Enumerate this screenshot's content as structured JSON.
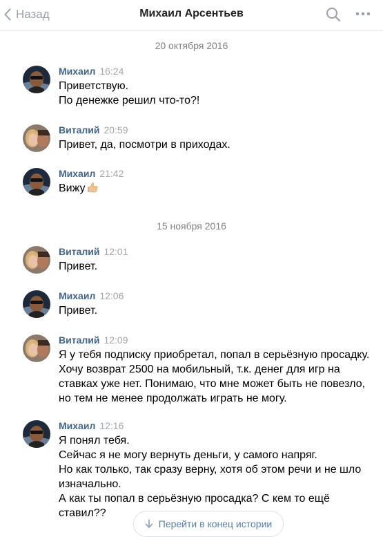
{
  "header": {
    "back_label": "Назад",
    "title": "Михаил Арсентьев",
    "icons": [
      "chevron-left-icon",
      "search-icon",
      "more-icon"
    ]
  },
  "dates": [
    "20 октября 2016",
    "15 ноября 2016"
  ],
  "messages": [
    {
      "author": "Михаил",
      "time": "16:24",
      "lines": [
        "Приветствую.",
        "По денежке решил что-то?!"
      ]
    },
    {
      "author": "Виталий",
      "time": "20:59",
      "lines": [
        "Привет, да, посмотри в приходах."
      ]
    },
    {
      "author": "Михаил",
      "time": "21:42",
      "lines": [
        "Вижу"
      ],
      "emoji": "thumbs-up-icon"
    },
    {
      "author": "Виталий",
      "time": "12:01",
      "lines": [
        "Привет."
      ]
    },
    {
      "author": "Михаил",
      "time": "12:06",
      "lines": [
        "Привет."
      ]
    },
    {
      "author": "Виталий",
      "time": "12:09",
      "lines": [
        "Я у тебя подписку приобретал, попал в серьёзную просадку.",
        "Хочу возврат 2500 на мобильный, т.к. денег для игр на",
        "ставках уже нет. Понимаю, что мне может быть не повезло,",
        "но тем не менее продолжать играть не могу."
      ]
    },
    {
      "author": "Михаил",
      "time": "12:16",
      "lines": [
        "Я понял тебя.",
        "Сейчас я не могу вернуть деньги, у самого напряг.",
        "Но как только, так сразу верну, хотя об этом речи и не шло",
        "изначально.",
        "А как ты попал в серьёзную просадка? С кем то ещё",
        "ставил??"
      ]
    }
  ],
  "jump_button": {
    "label": "Перейти в конец истории",
    "icon": "arrow-down-icon"
  },
  "colors": {
    "author": "#42648b",
    "time": "#a3a8ad",
    "date": "#828282",
    "link": "#5b7ea7"
  }
}
